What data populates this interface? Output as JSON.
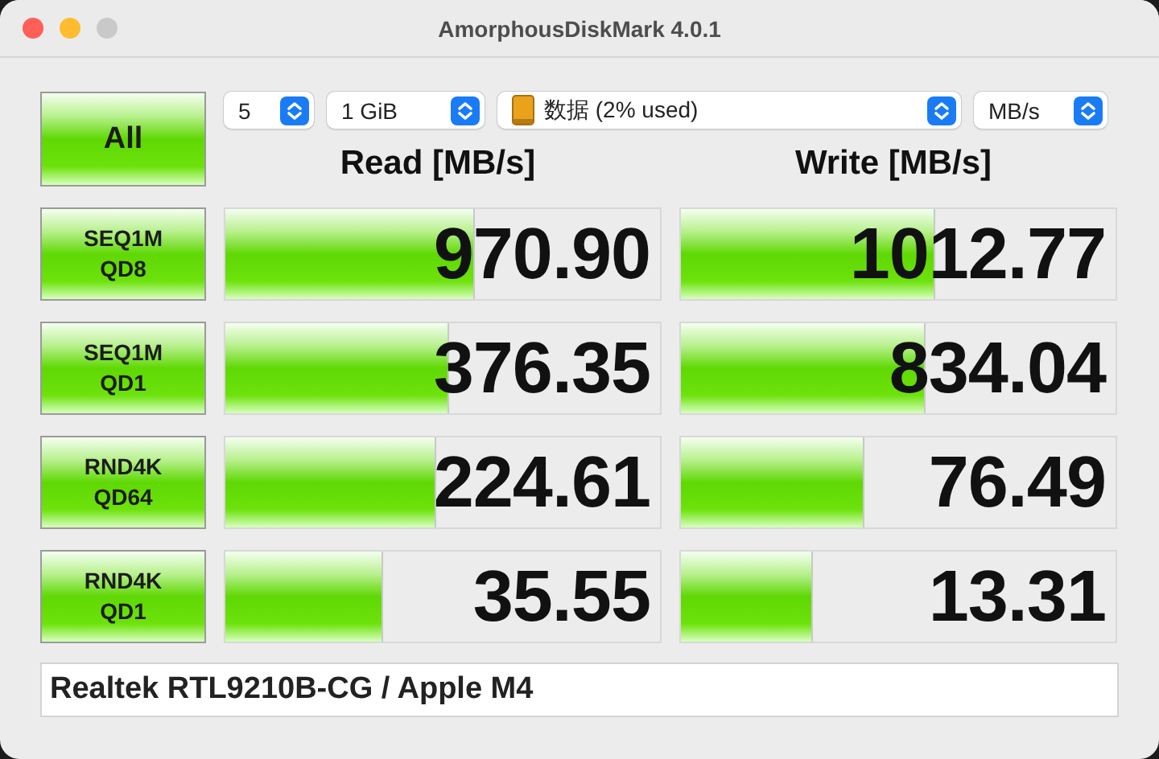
{
  "window": {
    "title": "AmorphousDiskMark 4.0.1"
  },
  "all_button": "All",
  "selects": [
    {
      "value": "5",
      "kind": "plain"
    },
    {
      "value": "1 GiB",
      "kind": "plain"
    },
    {
      "value": "数据 (2% used)",
      "kind": "disk"
    },
    {
      "value": "MB/s",
      "kind": "plain"
    }
  ],
  "headers": [
    "Read [MB/s]",
    "Write [MB/s]"
  ],
  "tests": [
    {
      "label": [
        "SEQ1M",
        "QD8"
      ],
      "read": {
        "value": "970.90",
        "level": 0.57
      },
      "write": {
        "value": "1012.77",
        "level": 0.58
      }
    },
    {
      "label": [
        "SEQ1M",
        "QD1"
      ],
      "read": {
        "value": "376.35",
        "level": 0.51
      },
      "write": {
        "value": "834.04",
        "level": 0.56
      }
    },
    {
      "label": [
        "RND4K",
        "QD64"
      ],
      "read": {
        "value": "224.61",
        "level": 0.48
      },
      "write": {
        "value": "76.49",
        "level": 0.42
      }
    },
    {
      "label": [
        "RND4K",
        "QD1"
      ],
      "read": {
        "value": "35.55",
        "level": 0.36
      },
      "write": {
        "value": "13.31",
        "level": 0.3
      }
    }
  ],
  "comment": "Realtek RTL9210B-CG / Apple M4"
}
